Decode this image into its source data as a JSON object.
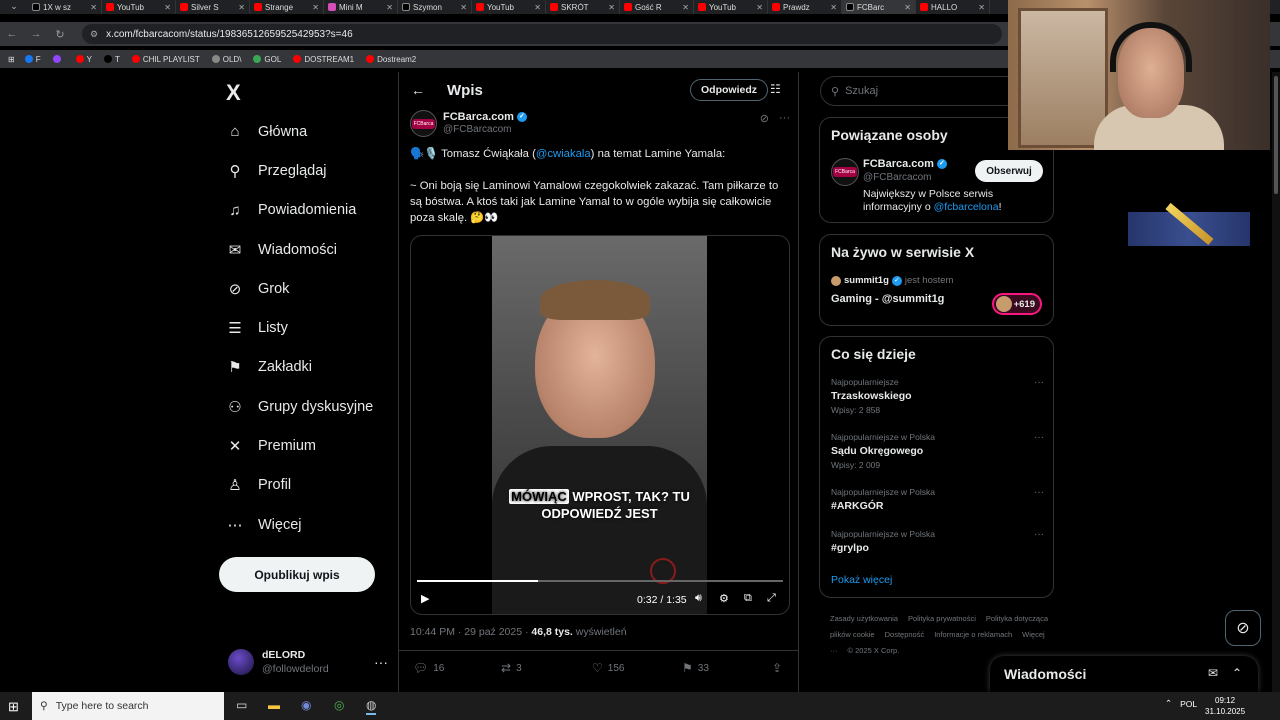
{
  "browser": {
    "tabs": [
      {
        "label": "1X w sz",
        "icon": "x"
      },
      {
        "label": "YouTub",
        "icon": "yt"
      },
      {
        "label": "Silver S",
        "icon": "yt"
      },
      {
        "label": "Strange",
        "icon": "yt"
      },
      {
        "label": "Mini M",
        "icon": "pink"
      },
      {
        "label": "Szymon",
        "icon": "x"
      },
      {
        "label": "YouTub",
        "icon": "yt"
      },
      {
        "label": "SKRÓT",
        "icon": "yt"
      },
      {
        "label": "Gość R",
        "icon": "yt"
      },
      {
        "label": "YouTub",
        "icon": "yt"
      },
      {
        "label": "Prawdz",
        "icon": "yt"
      },
      {
        "label": "FCBarc",
        "icon": "x",
        "active": true
      },
      {
        "label": "HALLO",
        "icon": "yt"
      }
    ],
    "url": "x.com/fcbarcacom/status/1983651265952542953?s=46",
    "bookmarks": [
      {
        "label": "F",
        "color": "#1877f2"
      },
      {
        "label": "",
        "color": "#9146ff"
      },
      {
        "label": "Y",
        "color": "#ff0000"
      },
      {
        "label": "T",
        "color": "#000000"
      },
      {
        "label": "CHIL PLAYLIST",
        "color": "#ff0000"
      },
      {
        "label": "OLD\\",
        "color": "#888888"
      },
      {
        "label": "GOL",
        "color": "#3aa757"
      },
      {
        "label": "DOSTREAM1",
        "color": "#ff0000"
      },
      {
        "label": "Dostream2",
        "color": "#ff0000"
      }
    ]
  },
  "sidebar": {
    "logo": "X",
    "items": [
      {
        "label": "Główna",
        "icon": "home-icon",
        "glyph": "⌂"
      },
      {
        "label": "Przeglądaj",
        "icon": "search-icon",
        "glyph": "⚲"
      },
      {
        "label": "Powiadomienia",
        "icon": "bell-icon",
        "glyph": "♫"
      },
      {
        "label": "Wiadomości",
        "icon": "mail-icon",
        "glyph": "✉"
      },
      {
        "label": "Grok",
        "icon": "grok-icon",
        "glyph": "⊘"
      },
      {
        "label": "Listy",
        "icon": "list-icon",
        "glyph": "☰"
      },
      {
        "label": "Zakładki",
        "icon": "bookmark-icon",
        "glyph": "⚑"
      },
      {
        "label": "Grupy dyskusyjne",
        "icon": "groups-icon",
        "glyph": "⚇"
      },
      {
        "label": "Premium",
        "icon": "x-premium-icon",
        "glyph": "✕"
      },
      {
        "label": "Profil",
        "icon": "profile-icon",
        "glyph": "♙"
      },
      {
        "label": "Więcej",
        "icon": "more-circle-icon",
        "glyph": "⋯"
      }
    ],
    "post_button": "Opublikuj wpis",
    "account": {
      "name": "dELORD",
      "handle": "@followdelord"
    }
  },
  "header": {
    "title": "Wpis",
    "reply_button": "Odpowiedz"
  },
  "tweet": {
    "author_name": "FCBarca.com",
    "author_handle": "@FCBarcacom",
    "avatar_text": "FCBarca",
    "line1_prefix": "🗣️🎙️ Tomasz Ćwiąkała (",
    "line1_mention": "@cwiakala",
    "line1_suffix": ") na temat Lamine Yamala:",
    "body": "~ Oni boją się Laminowi Yamalowi czegokolwiek zakazać. Tam piłkarze to są bóstwa. A ktoś taki jak Lamine Yamal to w ogóle wybija się całkowicie poza skalę. 🤔👀",
    "video": {
      "caption_highlight": "MÓWIĄC",
      "caption_rest": " WPROST, TAK? TU",
      "caption_line2": "ODPOWIEDŹ JEST",
      "time": "0:32 / 1:35",
      "progress": 0.33
    },
    "timestamp": "10:44 PM · 29 paź 2025 · ",
    "views_count": "46,8 tys.",
    "views_label": " wyświetleń",
    "replies": "16",
    "reposts": "3",
    "likes": "156",
    "bookmarks": "33"
  },
  "right": {
    "search_placeholder": "Szukaj",
    "related": {
      "title": "Powiązane osoby",
      "name": "FCBarca.com",
      "handle": "@FCBarcacom",
      "follow": "Obserwuj",
      "bio_prefix": "Największy w Polsce serwis informacyjny o ",
      "bio_mention": "@fcbarcelona",
      "bio_suffix": "!"
    },
    "live": {
      "title": "Na żywo w serwisie X",
      "host_name": "summit1g",
      "host_label": "jest hostem",
      "stream_title": "Gaming - @summit1g",
      "listeners": "+619"
    },
    "trends": {
      "title": "Co się dzieje",
      "items": [
        {
          "context": "Najpopularniejsze",
          "name": "Trzaskowskiego",
          "count": "Wpisy: 2 858"
        },
        {
          "context": "Najpopularniejsze w Polska",
          "name": "Sądu Okręgowego",
          "count": "Wpisy: 2 009"
        },
        {
          "context": "Najpopularniejsze w Polska",
          "name": "#ARKGÓR",
          "count": ""
        },
        {
          "context": "Najpopularniejsze w Polska",
          "name": "#grylpo",
          "count": ""
        }
      ],
      "show_more": "Pokaż więcej"
    },
    "footer": [
      "Zasady użytkowania",
      "Polityka prywatności",
      "Polityka dotycząca plików cookie",
      "Dostępność",
      "Informacje o reklamach",
      "Więcej ···",
      "© 2025 X Corp."
    ],
    "messages_drawer": "Wiadomości"
  },
  "taskbar": {
    "search_placeholder": "Type here to search",
    "language": "POL",
    "time": "09:12",
    "date": "31.10.2025"
  },
  "colors": {
    "accent": "#1d9bf0",
    "background": "#000000",
    "live_pink": "#f91880"
  }
}
